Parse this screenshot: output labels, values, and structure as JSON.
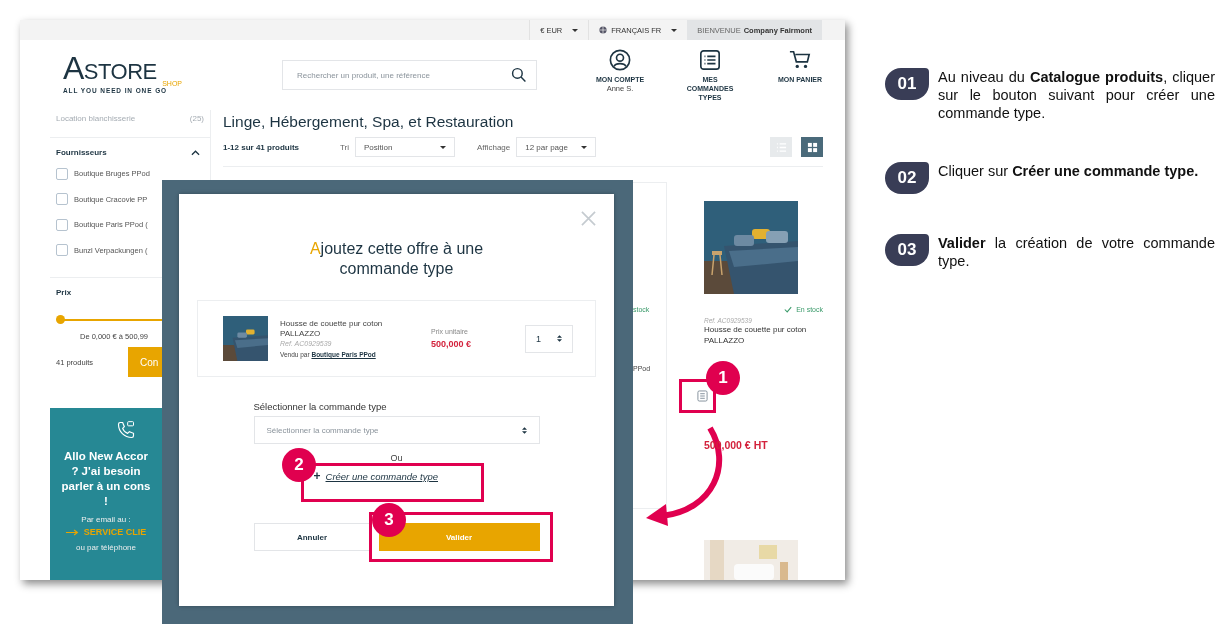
{
  "topbar": {
    "currency": "€ EUR",
    "language": "FRANÇAIS FR",
    "welcome_label": "BIENVENUE",
    "welcome_name": "Company Fairmont"
  },
  "header": {
    "logo_word": "ASTORE",
    "logo_sub": "SHOP",
    "tagline": "ALL YOU NEED IN ONE GO",
    "search": {
      "placeholder": "Rechercher un produit, une référence"
    },
    "links": [
      {
        "kind": "account",
        "label": "MON COMPTE",
        "sub": "Anne S."
      },
      {
        "kind": "orders",
        "label": "MES COMMANDES TYPES"
      },
      {
        "kind": "cart",
        "label": "MON PANIER"
      }
    ]
  },
  "sidebar": {
    "categories": [
      {
        "label": "Location blanchisserie",
        "count": "(25)"
      }
    ],
    "suppliers": {
      "title": "Fournisseurs",
      "expanded": true,
      "items": [
        {
          "label": "Boutique Bruges PPod",
          "checked": false
        },
        {
          "label": "Boutique Cracovie PP",
          "checked": false
        },
        {
          "label": "Boutique Paris PPod (",
          "checked": false
        },
        {
          "label": "Bunzl Verpackungen (",
          "checked": false
        }
      ]
    },
    "price": {
      "title": "Prix",
      "level": 0,
      "range": "De 0,000 € à 500,99",
      "count": "41 produits",
      "button": "Con"
    },
    "contact": {
      "lines": [
        "Allo New Accor",
        "? J'ai besoin",
        "parler à un cons",
        "!"
      ],
      "email_label": "Par email au :",
      "email_link": "SERVICE CLIE",
      "phone_label": "ou par téléphone"
    }
  },
  "main": {
    "title": "Linge, Hébergement, Spa, et Restauration",
    "count": "1-12 sur 41 produits",
    "sort_label": "Tri",
    "sort_value": "Position",
    "display_label": "Affichage",
    "display_value": "12 par page",
    "views": [
      {
        "kind": "list",
        "selected": false
      },
      {
        "kind": "grid",
        "selected": true
      }
    ],
    "partial_card": {
      "stock": "stock",
      "seller": "PPod"
    },
    "card": {
      "in_stock": true,
      "stock": "En stock",
      "ref": "Ref. AC0929539",
      "name": "Housse de couette pur coton PALLAZZO",
      "price": "500,000 € HT"
    }
  },
  "modal": {
    "title": "Ajoutez cette offre à une commande type",
    "product": {
      "name": "Housse de couette pur coton PALLAZZO",
      "ref": "Ref. AC0929539",
      "seller_label": "Vendu par",
      "seller": "Boutique Paris PPod",
      "price_label": "Prix unitaire",
      "price": "500,000 €",
      "quantity": "1"
    },
    "select_label": "Sélectionner la commande type",
    "select": {
      "placeholder": "Sélectionner la commande type"
    },
    "or": "Ou",
    "create_icon": "+",
    "create_link": "Créer une commande type",
    "cancel": "Annuler",
    "confirm": "Valider"
  },
  "callouts": [
    {
      "number": "1"
    },
    {
      "number": "2"
    },
    {
      "number": "3"
    }
  ],
  "steps": [
    {
      "number": "01",
      "text": "Au niveau du **Catalogue produits**, cliquer sur le bouton suivant pour créer une commande type."
    },
    {
      "number": "02",
      "text": "Cliquer sur **Créer une commande type.**"
    },
    {
      "number": "03",
      "text": "**Valider** la création de votre commande type."
    }
  ]
}
